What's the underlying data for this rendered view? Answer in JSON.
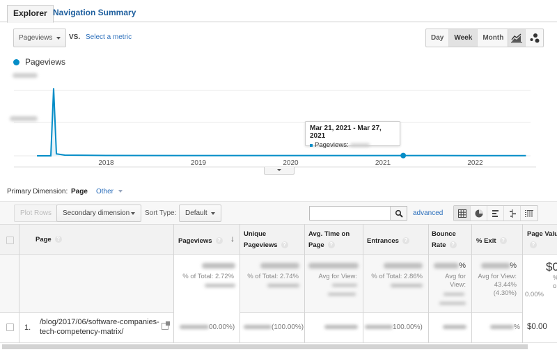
{
  "tabs": [
    {
      "label": "Explorer",
      "active": true
    },
    {
      "label": "Navigation Summary",
      "active": false
    }
  ],
  "metric": {
    "selected": "Pageviews",
    "vs_label": "VS.",
    "compare_link": "Select a metric"
  },
  "time_granularity": {
    "options": [
      "Day",
      "Week",
      "Month"
    ],
    "selected": "Week"
  },
  "chart_type_buttons": [
    {
      "icon": "line-chart-icon",
      "active": true
    },
    {
      "icon": "motion-chart-icon",
      "active": false
    }
  ],
  "legend": {
    "label": "Pageviews",
    "color": "#058dc7"
  },
  "chart_data": {
    "type": "line",
    "series": [
      {
        "name": "Pageviews",
        "color": "#058dc7"
      }
    ],
    "x_tick_labels": [
      "2018",
      "2019",
      "2020",
      "2021",
      "2022"
    ],
    "y_tick_labels": "obscured",
    "shape_description": "Near-zero flat line with a single sharp spike in mid-2017, then flat through late 2022",
    "points": [
      {
        "x": 2017.25,
        "y": 0.0
      },
      {
        "x": 2017.4,
        "y": 0.0
      },
      {
        "x": 2017.43,
        "y": 1.0
      },
      {
        "x": 2017.46,
        "y": 0.03
      },
      {
        "x": 2017.55,
        "y": 0.01
      },
      {
        "x": 2018.0,
        "y": 0.005
      },
      {
        "x": 2019.0,
        "y": 0.004
      },
      {
        "x": 2020.0,
        "y": 0.004
      },
      {
        "x": 2021.22,
        "y": 0.004
      },
      {
        "x": 2022.0,
        "y": 0.003
      },
      {
        "x": 2022.55,
        "y": 0.003
      }
    ],
    "x_range": [
      2017.0,
      2022.6
    ],
    "y_range_normalized": [
      0,
      1.05
    ],
    "highlight": {
      "x": 2021.22,
      "label": "Mar 21, 2021 - Mar 27, 2021"
    },
    "grid": true,
    "legend": "top-left"
  },
  "tooltip": {
    "date_range": "Mar 21, 2021 - Mar 27, 2021",
    "metric": "Pageviews:"
  },
  "primary_dimension": {
    "label": "Primary Dimension:",
    "value": "Page",
    "other": "Other"
  },
  "toolbar": {
    "plot_rows": "Plot Rows",
    "secondary_dimension": "Secondary dimension",
    "sort_type_label": "Sort Type:",
    "sort_type_value": "Default",
    "search_placeholder": "",
    "advanced": "advanced",
    "views": [
      "table-icon",
      "pie-icon",
      "bar-icon",
      "comparison-icon",
      "pivot-icon"
    ]
  },
  "table": {
    "headers": [
      {
        "key": "page",
        "label": "Page"
      },
      {
        "key": "pageviews",
        "label": "Pageviews",
        "sorted": "desc"
      },
      {
        "key": "unique",
        "label": "Unique Pageviews"
      },
      {
        "key": "avgtime",
        "label": "Avg. Time on Page"
      },
      {
        "key": "entrances",
        "label": "Entrances"
      },
      {
        "key": "bounce",
        "label": "Bounce Rate"
      },
      {
        "key": "exit",
        "label": "% Exit"
      },
      {
        "key": "value",
        "label": "Page Value"
      }
    ],
    "totals": {
      "pageviews_pct": "% of Total: 2.72%",
      "unique_pct": "% of Total: 2.74%",
      "avgtime_label": "Avg for View:",
      "entrances_pct": "% of Total: 2.86%",
      "bounce_suffix": "%",
      "bounce_label": "Avg for View:",
      "exit_suffix": "%",
      "exit_label": "Avg for View:",
      "exit_avg": "43.44%",
      "exit_delta": "(4.30%)",
      "value_main": "$0",
      "value_pct_label": "% o",
      "value_pct": "0.00%"
    },
    "rows": [
      {
        "index": "1.",
        "page": "/blog/2017/06/software-companies-tech-competency-matrix/",
        "pageviews_pct": "00.00%)",
        "unique_pct": "(100.00%)",
        "entrances_pct": "100.00%)",
        "exit_suffix": "%",
        "page_value": "$0.00"
      }
    ]
  }
}
